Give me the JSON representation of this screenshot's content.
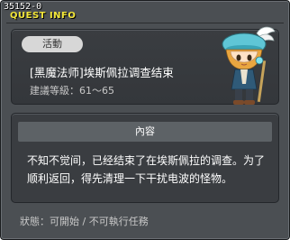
{
  "window": {
    "quest_id": "35152-0",
    "title": "QUEST INFO"
  },
  "header": {
    "badge": "活動",
    "quest_name": "[黑魔法师]埃斯佩拉调查结束",
    "level_label": "建議等級：",
    "level_range": "61～65"
  },
  "content": {
    "heading": "內容",
    "body": "不知不觉间，已经结束了在埃斯佩拉的调查。为了顺利返回，得先清理一下干扰电波的怪物。"
  },
  "status": {
    "label": "狀態：",
    "value": "可開始 / 不可執行任務"
  }
}
